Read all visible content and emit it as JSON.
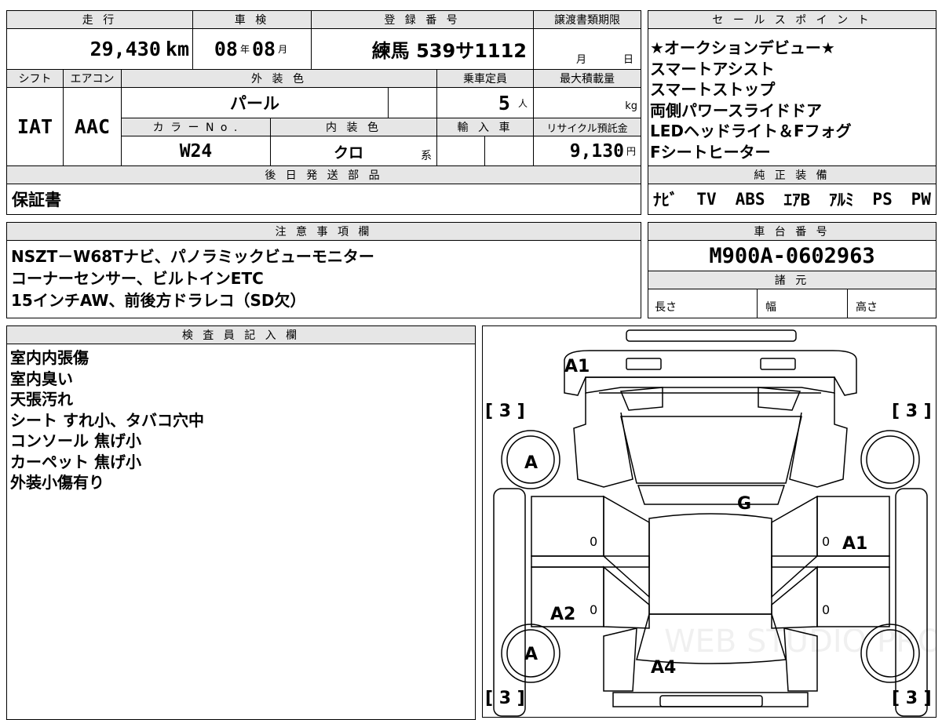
{
  "top_row": {
    "mileage_label": "走 行",
    "mileage_value": "29,430",
    "mileage_unit": "km",
    "inspection_label": "車 検",
    "inspection_year": "08",
    "inspection_year_unit": "年",
    "inspection_month": "08",
    "inspection_month_unit": "月",
    "registration_label": "登 録 番 号",
    "registration_value": "練馬 539サ1112",
    "transfer_label": "譲渡書類期限",
    "transfer_month_unit": "月",
    "transfer_day_unit": "日"
  },
  "spec_row": {
    "shift_label": "シフト",
    "shift_value": "IAT",
    "ac_label": "エアコン",
    "ac_value": "AAC",
    "exterior_label": "外 装 色",
    "exterior_value": "パール",
    "capacity_label": "乗車定員",
    "capacity_value": "5",
    "capacity_unit": "人",
    "load_label": "最大積載量",
    "load_unit": "kg",
    "color_no_label": "カ ラ ー N o .",
    "color_no_value": "W24",
    "interior_label": "内 装 色",
    "interior_value": "クロ",
    "interior_suffix": "系",
    "import_label": "輸 入 車",
    "recycle_label": "リサイクル預託金",
    "recycle_value": "9,130",
    "recycle_unit": "円"
  },
  "delivery": {
    "label": "後 日 発 送 部 品",
    "value": "保証書"
  },
  "sales_points": {
    "label": "セ ー ル ス ポ イ ン ト",
    "items": [
      "★オークションデビュー★",
      "スマートアシスト",
      "スマートストップ",
      "両側パワースライドドア",
      "LEDヘッドライト＆Fフォグ",
      "Fシートヒーター"
    ]
  },
  "equipment": {
    "label": "純 正 装 備",
    "items": [
      "ﾅﾋﾞ",
      "TV",
      "ABS",
      "ｴｱB",
      "ｱﾙﾐ",
      "PS",
      "PW"
    ]
  },
  "notes": {
    "label": "注 意 事 項 欄",
    "lines": [
      "NSZT－W68Tナビ、パノラミックビューモニター",
      "コーナーセンサー、ビルトインETC",
      "15インチAW、前後方ドラレコ（SD欠）"
    ]
  },
  "chassis": {
    "label": "車 台 番 号",
    "value": "M900A-0602963"
  },
  "dimensions": {
    "label": "諸 元",
    "length_label": "長さ",
    "width_label": "幅",
    "height_label": "高さ"
  },
  "inspector": {
    "label": "検 査 員 記 入 欄",
    "lines": [
      "室内内張傷",
      "室内臭い",
      "天張汚れ",
      "シート すれ小、タバコ穴中",
      "コンソール 焦げ小",
      "カーペット 焦げ小",
      "外装小傷有り"
    ]
  },
  "diagram": {
    "tire_left": "[ 3 ]",
    "tire_right": "[ 3 ]",
    "mark_front_bumper": "A1",
    "mark_front_left_wheel": "A",
    "mark_rear_left_wheel": "A",
    "mark_windshield": "G",
    "mark_right_front_door": "A1",
    "mark_left_rear_door": "A2",
    "mark_rear": "A4",
    "pillar_mark": "0",
    "watermark": "WEB STUDIO PRO"
  }
}
